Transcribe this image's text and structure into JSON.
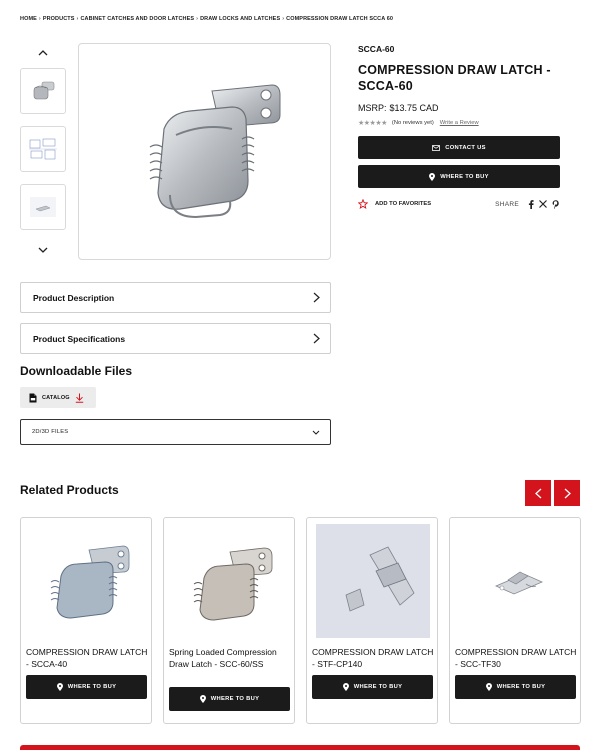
{
  "breadcrumb": [
    "HOME",
    "PRODUCTS",
    "CABINET CATCHES AND DOOR LATCHES",
    "DRAW LOCKS AND LATCHES",
    "COMPRESSION DRAW LATCH SCCA 60"
  ],
  "breadcrumb_separator": "›",
  "product": {
    "sku": "SCCA-60",
    "title": "COMPRESSION DRAW LATCH - SCCA-60",
    "price_label": "MSRP:",
    "price": "$13.75 CAD",
    "stars": "★★★★★",
    "reviews_text": "(No reviews yet)",
    "write_review": "Write a Review",
    "contact_button": "CONTACT US",
    "where_to_buy_button": "WHERE TO BUY",
    "favorites": "ADD TO FAVORITES",
    "share_label": "SHARE"
  },
  "accordions": {
    "description": "Product Description",
    "specifications": "Product Specifications"
  },
  "downloads": {
    "heading": "Downloadable Files",
    "catalog": "CATALOG",
    "select_value": "2D/3D FILES"
  },
  "related": {
    "heading": "Related Products",
    "items": [
      {
        "name": "COMPRESSION DRAW LATCH - SCCA-40",
        "button": "WHERE TO BUY"
      },
      {
        "name": "Spring Loaded Compression Draw Latch - SCC-60/SS",
        "button": "WHERE TO BUY"
      },
      {
        "name": "COMPRESSION DRAW LATCH - STF-CP140",
        "button": "WHERE TO BUY"
      },
      {
        "name": "COMPRESSION DRAW LATCH - SCC-TF30",
        "button": "WHERE TO BUY"
      }
    ]
  },
  "colors": {
    "accent_red": "#d4141c",
    "button_dark": "#1b1b1b",
    "border": "#d2d2d2"
  },
  "icons": [
    "chevron-up-icon",
    "chevron-down-icon",
    "mail-icon",
    "location-pin-icon",
    "star-outline-icon",
    "facebook-icon",
    "x-icon",
    "pinterest-icon",
    "chevron-right-icon",
    "pdf-file-icon",
    "download-icon",
    "arrow-left-icon",
    "arrow-right-icon"
  ]
}
